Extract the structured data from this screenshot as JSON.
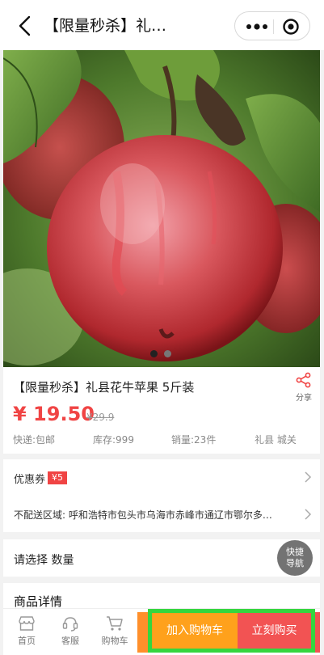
{
  "header": {
    "title": "【限量秒杀】礼…",
    "back_icon": "chevron-left-icon",
    "more_icon": "more-dots-icon",
    "close_icon": "target-circle-icon"
  },
  "gallery": {
    "image_alt": "red apple on branch",
    "dot_count": 2,
    "active_dot": 0
  },
  "product": {
    "name": "【限量秒杀】礼县花牛苹果 5斤装",
    "share_label": "分享",
    "price": "¥ 19.50",
    "original_price": "¥29.9",
    "shipping": "快递:包邮",
    "stock": "库存:999",
    "sales": "销量:23件",
    "origin": "礼县 城关"
  },
  "coupon": {
    "label": "优惠券",
    "badge": "¥5"
  },
  "delivery": {
    "restriction": "不配送区域: 呼和浩特市包头市乌海市赤峰市通辽市鄂尔多…"
  },
  "selection": {
    "label": "请选择 数量"
  },
  "quick_nav": {
    "line1": "快捷",
    "line2": "导航"
  },
  "details": {
    "label": "商品详情"
  },
  "bottom_bar": {
    "tabs": [
      {
        "label": "首页",
        "icon": "shop-icon"
      },
      {
        "label": "客服",
        "icon": "headset-icon"
      },
      {
        "label": "购物车",
        "icon": "cart-icon"
      }
    ],
    "add_to_cart": "加入购物车",
    "buy_now": "立刻购买"
  },
  "colors": {
    "price": "#f04444",
    "cart_button": "#ffa11c",
    "buy_button": "#f25353",
    "highlight_border": "#35d63f"
  }
}
